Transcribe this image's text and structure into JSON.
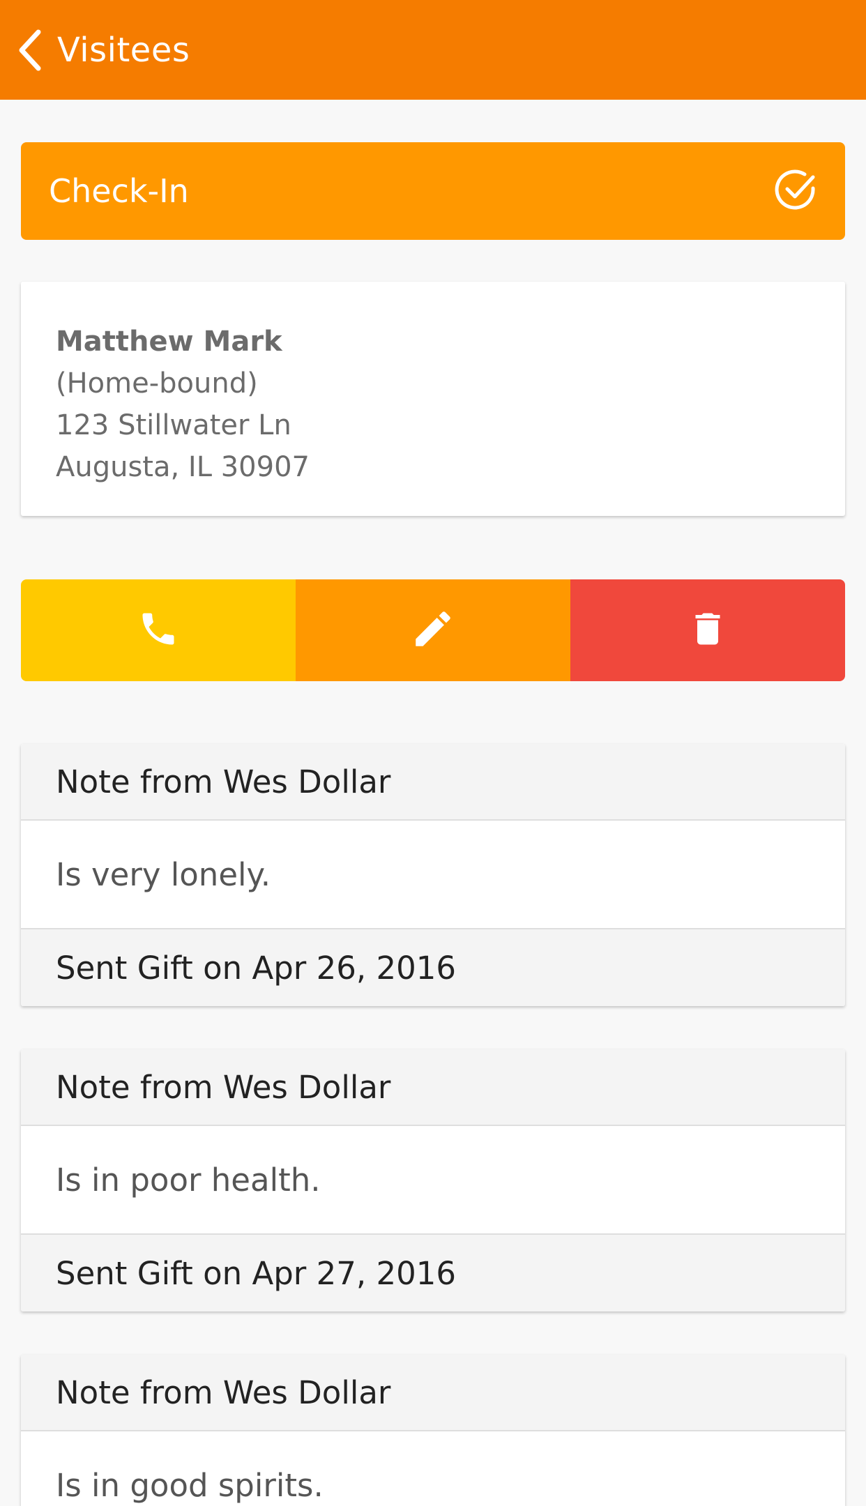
{
  "nav": {
    "back_label": "Visitees",
    "bar_color": "#f57c00"
  },
  "checkin": {
    "label": "Check-In",
    "icon": "check-circle-icon"
  },
  "contact": {
    "name": "Matthew Mark",
    "status": "(Home-bound)",
    "address_line1": "123 Stillwater Ln",
    "address_line2": "Augusta, IL 30907"
  },
  "actions": [
    {
      "icon": "phone-icon",
      "color": "#ffc900"
    },
    {
      "icon": "pencil-icon",
      "color": "#ff9800"
    },
    {
      "icon": "trash-icon",
      "color": "#f0483c"
    }
  ],
  "notes": [
    {
      "header": "Note from Wes Dollar",
      "body": "Is very lonely.",
      "footer": "Sent Gift on Apr 26, 2016"
    },
    {
      "header": "Note from Wes Dollar",
      "body": "Is in poor health.",
      "footer": "Sent Gift on Apr 27, 2016"
    },
    {
      "header": "Note from Wes Dollar",
      "body": "Is in good spirits."
    }
  ]
}
